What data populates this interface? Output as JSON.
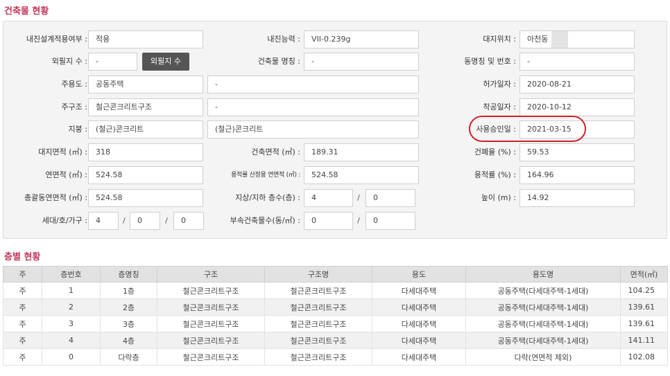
{
  "sections": {
    "building_status": "건축물 현황",
    "floor_status": "층별 현황"
  },
  "building": {
    "seismic_design_label": "내진설계적용여부 :",
    "seismic_design_value": "적용",
    "seismic_capacity_label": "내진능력 :",
    "seismic_capacity_value": "VII-0.239g",
    "site_location_label": "대지위치 :",
    "site_location_value": "아천동",
    "outer_count_label": "외필지 수 :",
    "outer_count_value": "-",
    "outer_count_button": "외필지 수",
    "building_name_label": "건축물 명칭 :",
    "building_name_value": "-",
    "dong_label": "동명칭 및 번호 :",
    "dong_value": "-",
    "main_use_label": "주용도 :",
    "main_use_value": "공동주택",
    "main_use_extra": "-",
    "permit_date_label": "허가일자 :",
    "permit_date_value": "2020-08-21",
    "structure_label": "주구조 :",
    "structure_value": "철근콘크리트구조",
    "structure_extra": "-",
    "start_date_label": "착공일자 :",
    "start_date_value": "2020-10-12",
    "roof_label": "지붕 :",
    "roof_value": "(철근)콘크리트",
    "roof_extra": "(철근)콘크리트",
    "approval_date_label": "사용승인일 :",
    "approval_date_value": "2021-03-15",
    "site_area_label": "대지면적 (㎡) :",
    "site_area_value": "318",
    "building_area_label": "건축면적 (㎡) :",
    "building_area_value": "189.31",
    "coverage_label": "건폐율 (%) :",
    "coverage_value": "59.53",
    "total_floor_area_label": "연면적 (㎡) :",
    "total_floor_area_value": "524.58",
    "far_area_label": "용적률 산정용 연면적 (㎡) :",
    "far_area_value": "524.58",
    "far_label": "용적률 (%) :",
    "far_value": "164.96",
    "gross_area_label": "총괄동연면적 (㎡) :",
    "gross_area_value": "524.58",
    "floors_label": "지상/지하 층수(층) :",
    "floors_above": "4",
    "floors_below": "0",
    "height_label": "높이 (m) :",
    "height_value": "14.92",
    "households_label": "세대/호/가구 :",
    "households": "4",
    "units": "0",
    "families": "0",
    "annex_label": "부속건축물수(동/㎡) :",
    "annex_count": "0",
    "annex_area": "0",
    "slash": "/"
  },
  "floor_table": {
    "headers": [
      "주",
      "층번호",
      "층명칭",
      "구조",
      "구조명",
      "용도",
      "용도명",
      "면적(㎡)"
    ],
    "rows": [
      [
        "주",
        "1",
        "1층",
        "철근콘크리트구조",
        "철근콘크리트구조",
        "다세대주택",
        "공동주택(다세대주택-1세대)",
        "104.25"
      ],
      [
        "주",
        "2",
        "2층",
        "철근콘크리트구조",
        "철근콘크리트구조",
        "다세대주택",
        "공동주택(다세대주택-1세대)",
        "139.61"
      ],
      [
        "주",
        "3",
        "3층",
        "철근콘크리트구조",
        "철근콘크리트구조",
        "다세대주택",
        "공동주택(다세대주택-1세대)",
        "139.61"
      ],
      [
        "주",
        "4",
        "4층",
        "철근콘크리트구조",
        "철근콘크리트구조",
        "다세대주택",
        "공동주택(다세대주택-1세대)",
        "141.11"
      ],
      [
        "주",
        "0",
        "다락층",
        "철근콘크리트구조",
        "철근콘크리트구조",
        "다세대주택",
        "다락(연면적 제외)",
        "102.08"
      ]
    ]
  },
  "colors": {
    "section_title": "#c4365a",
    "highlight_circle": "#d0202a",
    "button_bg": "#555555"
  }
}
